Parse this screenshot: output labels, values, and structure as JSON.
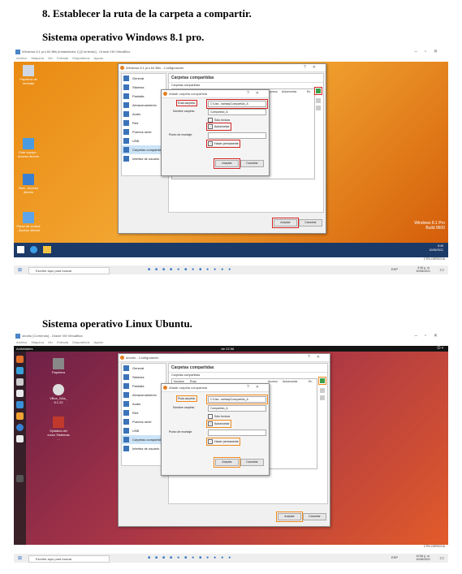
{
  "headings": {
    "step": "8. Establecer la ruta de la carpeta a compartir.",
    "windows_os": "Sistema operativo Windows 8.1 pro.",
    "ubuntu_os": "Sistema operativo Linux Ubuntu."
  },
  "win_shot": {
    "host_title": "Windows 8.1 pro 64 Bits [Instantánea 1] [Corriendo] - Oracle VM VirtualBox",
    "menu": [
      "Archivo",
      "Máquina",
      "Ver",
      "Entrada",
      "Dispositivos",
      "Ayuda"
    ],
    "desktop_icons": [
      "Papelera de reciclaje",
      "Este equipo - Acceso directo",
      "Red - Acceso directo",
      "Panel de control - Acceso directo"
    ],
    "watermark_line1": "Windows 8.1 Pro",
    "watermark_line2": "Build 9600",
    "guest_clock_time": "8:49",
    "guest_clock_date": "10/06/2021",
    "dialog_title": "Windows 8.1 pro 64 Bits - Configuración",
    "search_placeholder": "Escribe aquí para buscar",
    "host_clock_time": "9:45 p. m.",
    "host_clock_date": "10/06/2021",
    "host_lang": "ESP",
    "ctrl_label": "CTRL DERECHA"
  },
  "ub_shot": {
    "host_title": "ubuntu [Corriendo] - Oracle VM VirtualBox",
    "menu": [
      "Archivo",
      "Máquina",
      "Ver",
      "Entrada",
      "Dispositivos",
      "Ayuda"
    ],
    "activities": "Actividades",
    "clock": "vie 22:56",
    "desktop_icons": [
      "Papelera",
      "VBox_GAs_ 6.1.22",
      "Syllabus del curso Sistemas ..."
    ],
    "dialog_title": "ubuntu - Configuración",
    "search_placeholder": "Escribe aquí para buscar",
    "host_clock_time": "10:56 p. m.",
    "host_clock_date": "10/06/2021",
    "host_lang": "ESP",
    "ctrl_label": "CTRL DERECHA"
  },
  "settings": {
    "sidebar": [
      "General",
      "Sistema",
      "Pantalla",
      "Almacenamiento",
      "Audio",
      "Red",
      "Puertos serie",
      "USB",
      "Carpetas compartidas",
      "Interfaz de usuario"
    ],
    "header": "Carpetas compartidas",
    "subheader": "Carpetas compartidas",
    "columns": [
      "Nombre",
      "Ruta",
      "Acceso",
      "Automontar",
      "En"
    ],
    "ok": "Aceptar",
    "cancel": "Cancelar"
  },
  "add_share": {
    "title": "Añadir carpeta compartida",
    "path_label": "Ruta carpeta:",
    "path_value": "C:\\Use...ealmay\\Compartido_A",
    "name_label": "Nombre carpeta:",
    "name_value": "Compartido_A",
    "readonly": "Sólo lectura",
    "automount": "Automontar",
    "mount_label": "Punto de montaje:",
    "permanent": "Hacer permanente",
    "ok": "Aceptar",
    "cancel": "Cancelar"
  },
  "colors": {
    "win_highlight": "#d62424",
    "ubuntu_highlight": "#f08a1c"
  }
}
